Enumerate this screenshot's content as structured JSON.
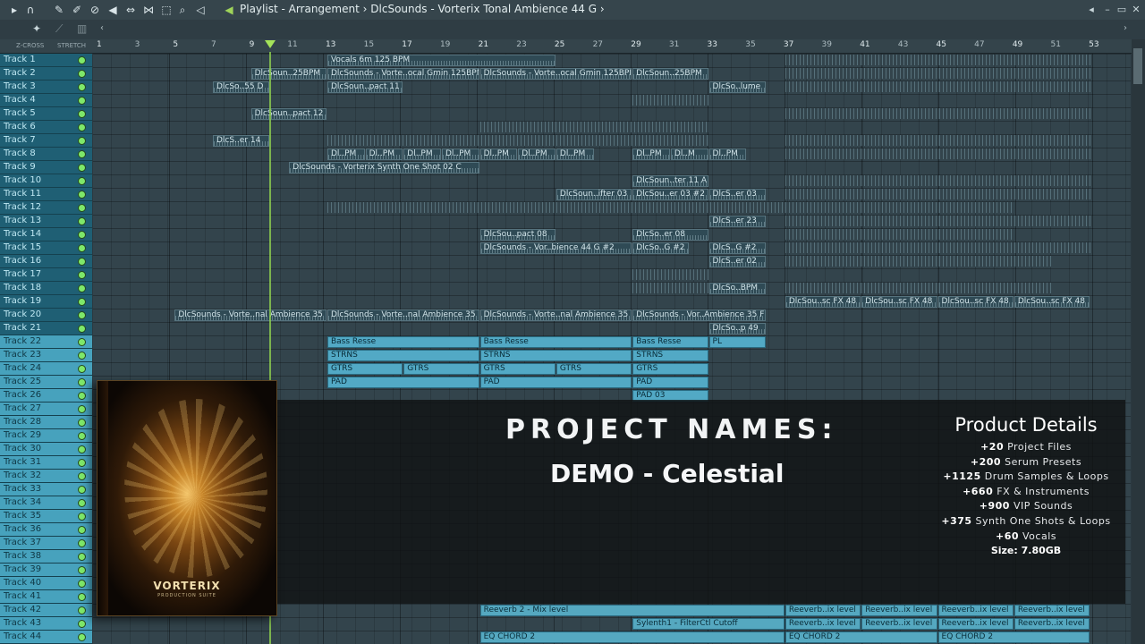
{
  "window": {
    "title": "Playlist - Arrangement",
    "separator": "›",
    "pattern": "DlcSounds - Vorterix Tonal Ambience 44 G",
    "colors": {
      "track_header": "#1f5f74",
      "track_header_selected": "#47a2bd",
      "pattern_clip": "#52a9c5",
      "playhead": "#8fd14f"
    }
  },
  "toolbar": {
    "icons": [
      "magnet-icon",
      "paint-icon",
      "draw-icon",
      "delete-icon",
      "mute-icon",
      "slip-icon",
      "select-icon",
      "zoom-icon",
      "playback-icon"
    ]
  },
  "ruler": {
    "zcross_label": "Z-CROSS",
    "stretch_label": "STRETCH",
    "bars": [
      "1",
      "3",
      "5",
      "7",
      "9",
      "11",
      "13",
      "15",
      "17",
      "19",
      "21",
      "23",
      "25",
      "27",
      "29",
      "31",
      "33",
      "35",
      "37",
      "39",
      "41",
      "43",
      "45",
      "47",
      "49",
      "51",
      "53"
    ]
  },
  "tracks": [
    "Track 1",
    "Track 2",
    "Track 3",
    "Track 4",
    "Track 5",
    "Track 6",
    "Track 7",
    "Track 8",
    "Track 9",
    "Track 10",
    "Track 11",
    "Track 12",
    "Track 13",
    "Track 14",
    "Track 15",
    "Track 16",
    "Track 17",
    "Track 18",
    "Track 19",
    "Track 20",
    "Track 21",
    "Track 22",
    "Track 23",
    "Track 24",
    "Track 25",
    "Track 26",
    "Track 27",
    "Track 28",
    "Track 29",
    "Track 30",
    "Track 31",
    "Track 32",
    "Track 33",
    "Track 34",
    "Track 35",
    "Track 36",
    "Track 37",
    "Track 38",
    "Track 39",
    "Track 40",
    "Track 41",
    "Track 42",
    "Track 43",
    "Track 44"
  ],
  "clips": [
    {
      "track": 1,
      "bar": 13,
      "len": 12,
      "label": "Vocals 6m 125 BPM"
    },
    {
      "track": 2,
      "bar": 9,
      "len": 4,
      "label": "DlcSoun..25BPM"
    },
    {
      "track": 2,
      "bar": 13,
      "len": 8,
      "label": "DlcSounds - Vorte..ocal Gmin 125BPM"
    },
    {
      "track": 2,
      "bar": 21,
      "len": 8,
      "label": "DlcSounds - Vorte..ocal Gmin 125BPM"
    },
    {
      "track": 2,
      "bar": 29,
      "len": 4,
      "label": "DlcSoun..25BPM"
    },
    {
      "track": 3,
      "bar": 7,
      "len": 3,
      "label": "DlcSo..55 D"
    },
    {
      "track": 3,
      "bar": 13,
      "len": 4,
      "label": "DlcSoun..pact 11"
    },
    {
      "track": 3,
      "bar": 33,
      "len": 3,
      "label": "DlcSo..lume"
    },
    {
      "track": 5,
      "bar": 9,
      "len": 4,
      "label": "DlcSoun..pact 12"
    },
    {
      "track": 7,
      "bar": 7,
      "len": 3,
      "label": "DlcS..er 14"
    },
    {
      "track": 8,
      "bar": 13,
      "len": 2,
      "label": "Dl..PM"
    },
    {
      "track": 8,
      "bar": 15,
      "len": 2,
      "label": "Dl..PM"
    },
    {
      "track": 8,
      "bar": 17,
      "len": 2,
      "label": "Dl..PM"
    },
    {
      "track": 8,
      "bar": 19,
      "len": 2,
      "label": "Dl..PM"
    },
    {
      "track": 8,
      "bar": 21,
      "len": 2,
      "label": "Dl..PM"
    },
    {
      "track": 8,
      "bar": 23,
      "len": 2,
      "label": "Dl..PM"
    },
    {
      "track": 8,
      "bar": 25,
      "len": 2,
      "label": "Dl..PM"
    },
    {
      "track": 8,
      "bar": 29,
      "len": 2,
      "label": "Dl..PM"
    },
    {
      "track": 8,
      "bar": 31,
      "len": 2,
      "label": "Dl..M"
    },
    {
      "track": 8,
      "bar": 33,
      "len": 2,
      "label": "Dl..PM"
    },
    {
      "track": 9,
      "bar": 11,
      "len": 10,
      "label": "DlcSounds - Vorterix Synth One Shot 02 C"
    },
    {
      "track": 10,
      "bar": 29,
      "len": 4,
      "label": "DlcSoun..ter 11 A"
    },
    {
      "track": 11,
      "bar": 25,
      "len": 4,
      "label": "DlcSoun..ifter 03"
    },
    {
      "track": 11,
      "bar": 29,
      "len": 4,
      "label": "DlcSou..er 03 #2"
    },
    {
      "track": 11,
      "bar": 33,
      "len": 3,
      "label": "DlcS..er 03"
    },
    {
      "track": 13,
      "bar": 33,
      "len": 3,
      "label": "DlcS..er 23"
    },
    {
      "track": 14,
      "bar": 21,
      "len": 4,
      "label": "DlcSou..pact 08"
    },
    {
      "track": 14,
      "bar": 29,
      "len": 4,
      "label": "DlcSo..er 08"
    },
    {
      "track": 15,
      "bar": 21,
      "len": 8,
      "label": "DlcSounds - Vor..bience 44 G #2"
    },
    {
      "track": 15,
      "bar": 29,
      "len": 3,
      "label": "DlcSo..G #2"
    },
    {
      "track": 15,
      "bar": 33,
      "len": 3,
      "label": "DlcS..G #2"
    },
    {
      "track": 16,
      "bar": 33,
      "len": 3,
      "label": "DlcS..er 02"
    },
    {
      "track": 18,
      "bar": 33,
      "len": 3,
      "label": "DlcSo..BPM"
    },
    {
      "track": 19,
      "bar": 37,
      "len": 4,
      "label": "DlcSou..sc FX 48"
    },
    {
      "track": 19,
      "bar": 41,
      "len": 4,
      "label": "DlcSou..sc FX 48"
    },
    {
      "track": 19,
      "bar": 45,
      "len": 4,
      "label": "DlcSou..sc FX 48"
    },
    {
      "track": 19,
      "bar": 49,
      "len": 4,
      "label": "DlcSou..sc FX 48"
    },
    {
      "track": 20,
      "bar": 5,
      "len": 8,
      "label": "DlcSounds - Vorte..nal Ambience 35 F"
    },
    {
      "track": 20,
      "bar": 13,
      "len": 8,
      "label": "DlcSounds - Vorte..nal Ambience 35 F"
    },
    {
      "track": 20,
      "bar": 21,
      "len": 8,
      "label": "DlcSounds - Vorte..nal Ambience 35 F"
    },
    {
      "track": 20,
      "bar": 29,
      "len": 7,
      "label": "DlcSounds - Vor..Ambience 35 F"
    },
    {
      "track": 21,
      "bar": 33,
      "len": 3,
      "label": "DlcSo..p 49"
    }
  ],
  "pattern_clips": [
    {
      "track": 22,
      "bar": 13,
      "len": 8,
      "label": "Bass Resse"
    },
    {
      "track": 22,
      "bar": 21,
      "len": 8,
      "label": "Bass Resse"
    },
    {
      "track": 22,
      "bar": 29,
      "len": 4,
      "label": "Bass Resse"
    },
    {
      "track": 22,
      "bar": 33,
      "len": 3,
      "label": "PL"
    },
    {
      "track": 23,
      "bar": 13,
      "len": 8,
      "label": "STRNS"
    },
    {
      "track": 23,
      "bar": 21,
      "len": 8,
      "label": "STRNS"
    },
    {
      "track": 23,
      "bar": 29,
      "len": 4,
      "label": "STRNS"
    },
    {
      "track": 24,
      "bar": 13,
      "len": 4,
      "label": "GTRS"
    },
    {
      "track": 24,
      "bar": 17,
      "len": 4,
      "label": "GTRS"
    },
    {
      "track": 24,
      "bar": 21,
      "len": 4,
      "label": "GTRS"
    },
    {
      "track": 24,
      "bar": 25,
      "len": 4,
      "label": "GTRS"
    },
    {
      "track": 24,
      "bar": 29,
      "len": 4,
      "label": "GTRS"
    },
    {
      "track": 25,
      "bar": 13,
      "len": 8,
      "label": "PAD"
    },
    {
      "track": 25,
      "bar": 21,
      "len": 8,
      "label": "PAD"
    },
    {
      "track": 25,
      "bar": 29,
      "len": 4,
      "label": "PAD"
    },
    {
      "track": 26,
      "bar": 29,
      "len": 4,
      "label": "PAD 03"
    }
  ],
  "automation_clips": [
    {
      "track": 42,
      "bar": 21,
      "len": 16,
      "label": "Reeverb 2 - Mix level"
    },
    {
      "track": 42,
      "bar": 37,
      "len": 4,
      "label": "Reeverb..ix level"
    },
    {
      "track": 42,
      "bar": 41,
      "len": 4,
      "label": "Reeverb..ix level"
    },
    {
      "track": 42,
      "bar": 45,
      "len": 4,
      "label": "Reeverb..ix level"
    },
    {
      "track": 42,
      "bar": 49,
      "len": 4,
      "label": "Reeverb..ix level"
    },
    {
      "track": 43,
      "bar": 29,
      "len": 8,
      "label": "Sylenth1 - FilterCtl Cutoff"
    },
    {
      "track": 43,
      "bar": 37,
      "len": 4,
      "label": "Reeverb..ix level"
    },
    {
      "track": 43,
      "bar": 41,
      "len": 4,
      "label": "Reeverb..ix level"
    },
    {
      "track": 43,
      "bar": 45,
      "len": 4,
      "label": "Reeverb..ix level"
    },
    {
      "track": 43,
      "bar": 49,
      "len": 4,
      "label": "Reeverb..ix level"
    },
    {
      "track": 44,
      "bar": 21,
      "len": 16,
      "label": "EQ CHORD 2"
    },
    {
      "track": 44,
      "bar": 37,
      "len": 8,
      "label": "EQ CHORD 2"
    },
    {
      "track": 44,
      "bar": 45,
      "len": 8,
      "label": "EQ CHORD 2"
    }
  ],
  "promo": {
    "headline": "PROJECT NAMES:",
    "demo_name": "DEMO - Celestial",
    "details_title": "Product Details",
    "details": [
      {
        "num": "+20",
        "text": " Project Files"
      },
      {
        "num": "+200",
        "text": " Serum Presets"
      },
      {
        "num": "+1125",
        "text": " Drum Samples & Loops"
      },
      {
        "num": "+660",
        "text": " FX & Instruments"
      },
      {
        "num": "+900",
        "text": " VIP Sounds"
      },
      {
        "num": "+375",
        "text": " Synth One Shots & Loops"
      },
      {
        "num": "+60",
        "text": " Vocals"
      }
    ],
    "size": "Size: 7.80GB",
    "box_brand": "VORTERIX",
    "box_sub": "PRODUCTION SUITE"
  }
}
